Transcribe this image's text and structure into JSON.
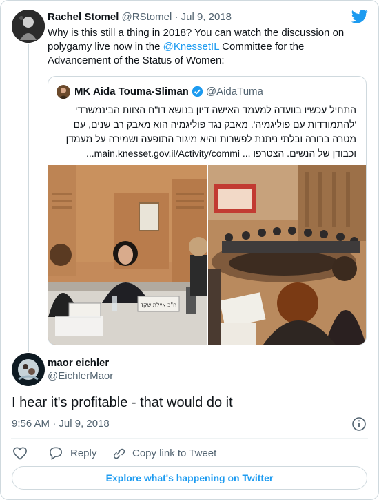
{
  "colors": {
    "accent": "#1d9bf0",
    "muted": "#536471",
    "border": "#cfd9de"
  },
  "retweeted": {
    "display_name": "Rachel Stomel",
    "handle": "@RStomel",
    "separator": "·",
    "date": "Jul 9, 2018",
    "text_before": "Why is this still a thing in 2018? You can watch the discussion on polygamy live now in the ",
    "mention": "@KnessetIL",
    "text_after": " Committee for the Advancement of the Status of Women:"
  },
  "quoted": {
    "display_name": "MK Aida Touma-Sliman",
    "handle": "@AidaTuma",
    "lines": [
      "התחיל עכשיו בוועדה למעמד האישה דיון בנושא דו\"ח הצוות הבינמשרדי",
      "'להתמודדות עם פוליגמיה'. מאבק נגד פוליגמיה הוא מאבק רב שנים, עם",
      "מטרה ברורה ובלתי ניתנת לפשרות והיא מיגור התופעה ושמירה על מעמדן",
      "וכבודן של הנשים. הצטרפו ... main.knesset.gov.il/Activity/commi..."
    ],
    "nameplate": "ח\"כ איילת שקד"
  },
  "tweet": {
    "display_name": "maor eichler",
    "handle": "@EichlerMaor",
    "text": "I hear it's profitable - that would do it",
    "time": "9:56 AM",
    "separator": "·",
    "date": "Jul 9, 2018"
  },
  "actions": {
    "like_icon": "heart-icon",
    "reply_label": "Reply",
    "copy_label": "Copy link to Tweet"
  },
  "explore_label": "Explore what's happening on Twitter",
  "icons": [
    "twitter-bird-icon",
    "verified-badge-icon",
    "info-icon",
    "heart-icon",
    "reply-icon",
    "link-icon"
  ]
}
